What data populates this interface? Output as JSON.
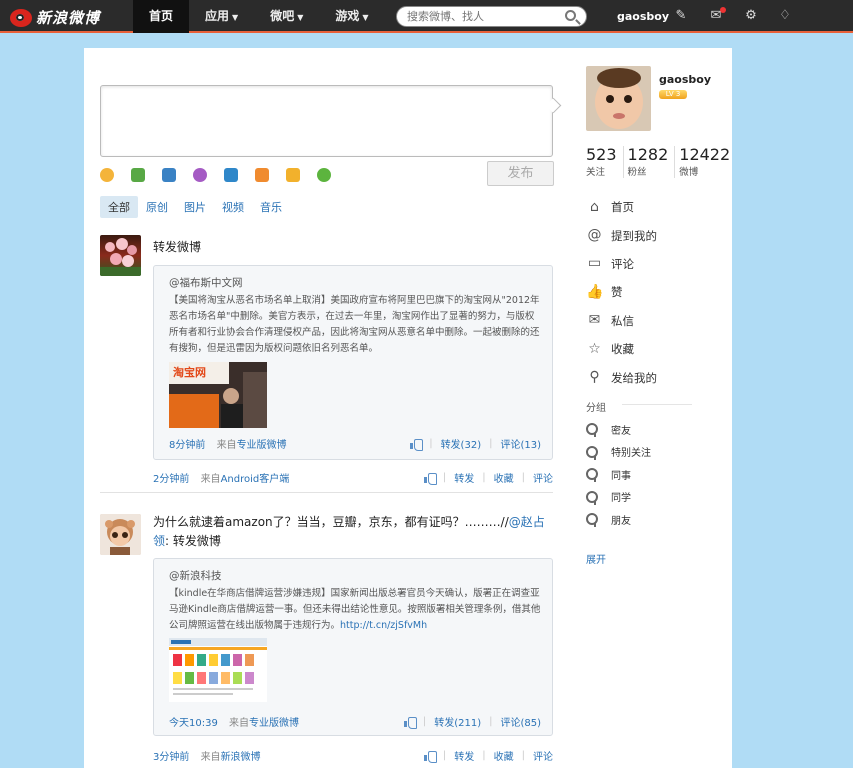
{
  "header": {
    "logo_text": "新浪微博",
    "nav": [
      {
        "label": "首页",
        "active": true,
        "dropdown": false
      },
      {
        "label": "应用",
        "active": false,
        "dropdown": true
      },
      {
        "label": "微吧",
        "active": false,
        "dropdown": true
      },
      {
        "label": "游戏",
        "active": false,
        "dropdown": true
      }
    ],
    "search_placeholder": "搜索微博、找人",
    "username": "gaosboy",
    "icons": [
      "edit-icon",
      "message-icon",
      "gear-icon",
      "diamond-icon"
    ]
  },
  "compose": {
    "publish_label": "发布",
    "tools": [
      "emoji-icon",
      "image-icon",
      "video-icon",
      "music-icon",
      "topic-icon",
      "vote-icon",
      "heart-icon",
      "more-icon"
    ],
    "filters": [
      "全部",
      "原创",
      "图片",
      "视频",
      "音乐"
    ],
    "active_filter": "全部"
  },
  "feed": [
    {
      "text": "转发微博",
      "mention": "",
      "quote": {
        "author": "@福布斯中文网",
        "text": "【美国将淘宝从恶名市场名单上取消】美国政府宣布将阿里巴巴旗下的淘宝网从\"2012年恶名市场名单\"中删除。美官方表示，在过去一年里，淘宝网作出了显著的努力，与版权所有者和行业协会合作清理侵权产品，因此将淘宝网从恶意名单中删除。一起被删除的还有搜狗，但是迅雷因为版权问题依旧名列恶名单。",
        "link": "",
        "time": "8分钟前",
        "source_prefix": "来自",
        "source": "专业版微博",
        "repost": "转发(32)",
        "comment": "评论(13)"
      },
      "time": "2分钟前",
      "source_prefix": "来自",
      "source": "Android客户端",
      "actions": [
        "转发",
        "收藏",
        "评论"
      ]
    },
    {
      "text": "为什么就逮着amazon了？当当，豆瓣，京东，都有证吗？………//",
      "mention": "@赵占领",
      "text_after": ": 转发微博",
      "quote": {
        "author": "@新浪科技",
        "text": "【kindle在华商店借牌运营涉嫌违规】国家新闻出版总署官员今天确认，版署正在调查亚马逊Kindle商店借牌运营一事。但还未得出结论性意见。按照版署相关管理条例，借其他公司牌照运营在线出版物属于违规行为。",
        "link": "http://t.cn/zjSfvMh",
        "time": "今天10:39",
        "source_prefix": "来自",
        "source": "专业版微博",
        "repost": "转发(211)",
        "comment": "评论(85)"
      },
      "time": "3分钟前",
      "source_prefix": "来自",
      "source": "新浪微博",
      "actions": [
        "转发",
        "收藏",
        "评论"
      ]
    }
  ],
  "sidebar": {
    "username": "gaosboy",
    "badge": "LV 3",
    "stats": [
      {
        "num": "523",
        "label": "关注"
      },
      {
        "num": "1282",
        "label": "粉丝"
      },
      {
        "num": "12422",
        "label": "微博"
      }
    ],
    "menu": [
      {
        "label": "首页",
        "icon": "home-icon",
        "glyph": "⌂"
      },
      {
        "label": "提到我的",
        "icon": "at-icon",
        "glyph": "@"
      },
      {
        "label": "评论",
        "icon": "comment-icon",
        "glyph": "▭"
      },
      {
        "label": "赞",
        "icon": "thumb-up-icon",
        "glyph": "👍"
      },
      {
        "label": "私信",
        "icon": "mail-icon",
        "glyph": "✉"
      },
      {
        "label": "收藏",
        "icon": "star-icon",
        "glyph": "☆"
      },
      {
        "label": "发给我的",
        "icon": "user-icon",
        "glyph": "⚲"
      }
    ],
    "group_title": "分组",
    "groups": [
      "密友",
      "特别关注",
      "同事",
      "同学",
      "朋友"
    ],
    "expand_label": "展开"
  }
}
